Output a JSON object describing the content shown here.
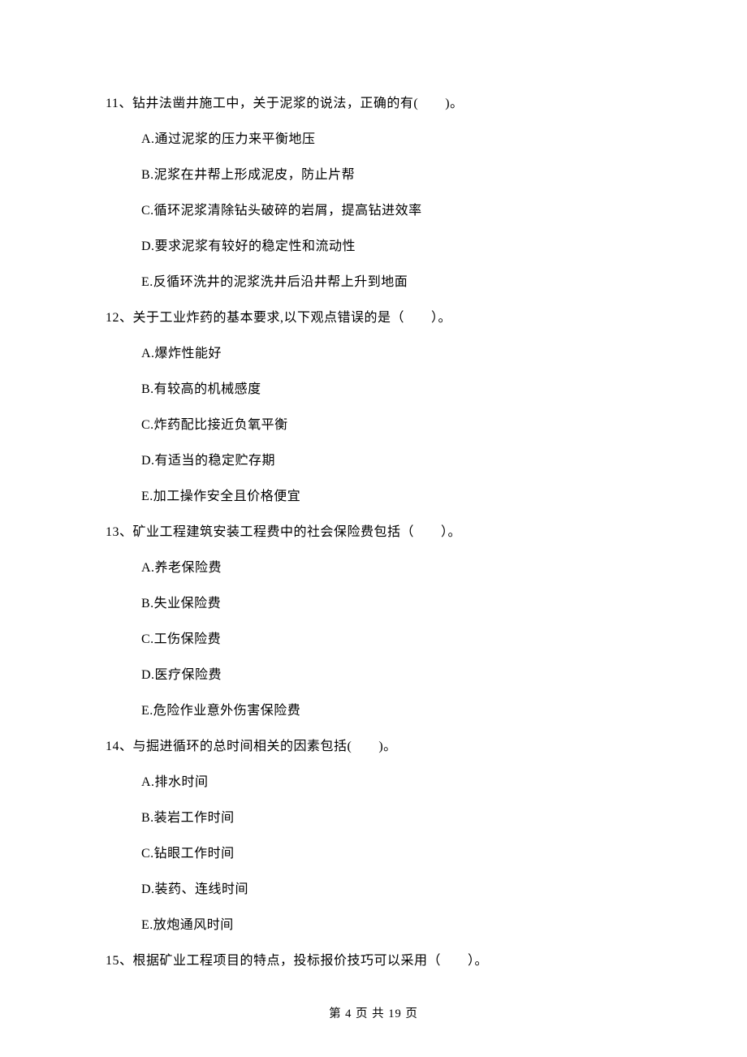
{
  "questions": [
    {
      "number": "11、",
      "stem": "钻井法凿井施工中，关于泥浆的说法，正确的有(　　)。",
      "options": [
        "A.通过泥浆的压力来平衡地压",
        "B.泥浆在井帮上形成泥皮，防止片帮",
        "C.循环泥浆清除钻头破碎的岩屑，提高钻进效率",
        "D.要求泥浆有较好的稳定性和流动性",
        "E.反循环洗井的泥浆洗井后沿井帮上升到地面"
      ]
    },
    {
      "number": "12、",
      "stem": "关于工业炸药的基本要求,以下观点错误的是（　　）。",
      "options": [
        "A.爆炸性能好",
        "B.有较高的机械感度",
        "C.炸药配比接近负氧平衡",
        "D.有适当的稳定贮存期",
        "E.加工操作安全且价格便宜"
      ]
    },
    {
      "number": "13、",
      "stem": "矿业工程建筑安装工程费中的社会保险费包括（　　）。",
      "options": [
        "A.养老保险费",
        "B.失业保险费",
        "C.工伤保险费",
        "D.医疗保险费",
        "E.危险作业意外伤害保险费"
      ]
    },
    {
      "number": "14、",
      "stem": "与掘进循环的总时间相关的因素包括(　　)。",
      "options": [
        "A.排水时间",
        "B.装岩工作时间",
        "C.钻眼工作时间",
        "D.装药、连线时间",
        "E.放炮通风时间"
      ]
    },
    {
      "number": "15、",
      "stem": "根据矿业工程项目的特点，投标报价技巧可以采用（　　）。",
      "options": []
    }
  ],
  "footer": "第 4 页 共 19 页"
}
